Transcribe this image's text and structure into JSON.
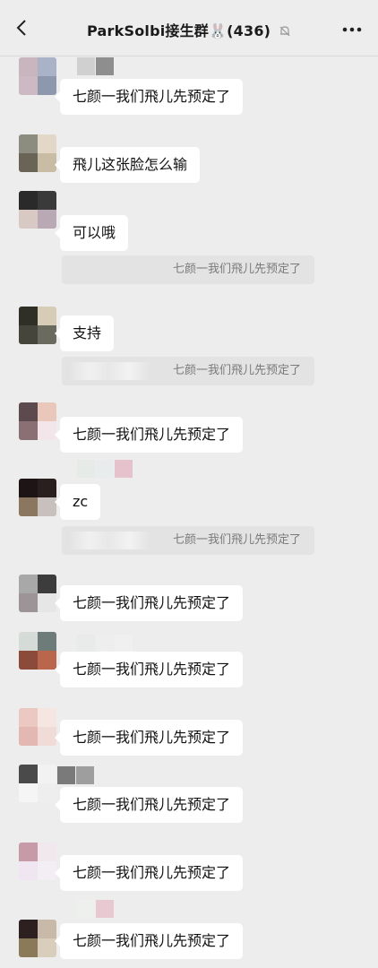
{
  "header": {
    "title": "ParkSolbi接生群",
    "title_emoji": "🐰",
    "member_count": "(436)",
    "icons": [
      "back-arrow-icon",
      "mute-bell-icon",
      "more-dots-icon"
    ]
  },
  "messages": [
    {
      "text": "七颜一我们飛儿先预定了"
    },
    {
      "text": "飛儿这张脸怎么输"
    },
    {
      "text": "可以哦"
    },
    {
      "text": "支持"
    },
    {
      "text": "七颜一我们飛儿先预定了"
    },
    {
      "text": "zc"
    },
    {
      "text": "七颜一我们飛儿先预定了"
    },
    {
      "text": "七颜一我们飛儿先预定了"
    },
    {
      "text": "七颜一我们飛儿先预定了"
    },
    {
      "text": "七颜一我们飛儿先预定了"
    },
    {
      "text": "七颜一我们飛儿先预定了"
    },
    {
      "text": "七颜一我们飛儿先预定了"
    }
  ],
  "quotes": [
    {
      "text": "七颜一我们飛儿先预定了"
    },
    {
      "text": "七颜一我们飛儿先预定了"
    },
    {
      "text": "七颜一我们飛儿先预定了"
    }
  ],
  "colors": {
    "background": "#ededed",
    "bubble": "#ffffff",
    "quote_bg": "#e3e3e3",
    "quote_text": "#7a7a7a"
  }
}
